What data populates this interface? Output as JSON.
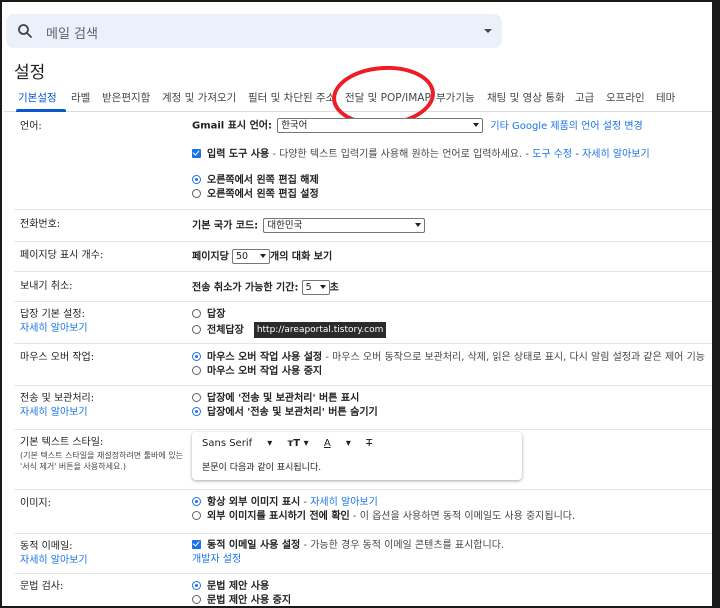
{
  "search": {
    "placeholder": "메일 검색",
    "icon": "search-icon",
    "options_icon": "dropdown-icon"
  },
  "page": {
    "title": "설정"
  },
  "tabs": [
    {
      "label": "기본설정"
    },
    {
      "label": "라벨"
    },
    {
      "label": "받은편지함"
    },
    {
      "label": "계정 및 가져오기"
    },
    {
      "label": "필터 및 차단된 주소"
    },
    {
      "label": "전달 및 POP/IMAP"
    },
    {
      "label": "부가기능"
    },
    {
      "label": "채팅 및 영상 통화"
    },
    {
      "label": "고급"
    },
    {
      "label": "오프라인"
    },
    {
      "label": "테마"
    }
  ],
  "annotation_color": "#ee1c25",
  "accent_color": "#1a73e8",
  "language": {
    "label": "언어:",
    "display_label": "Gmail 표시 언어:",
    "display_value": "한국어",
    "other_link": "기타 Google 제품의 언어 설정 변경",
    "input_tools_text": "입력 도구 사용",
    "input_tools_desc": " - 다양한 텍스트 입력기를 사용해 원하는 언어로 입력하세요. - ",
    "tool_edit_link": "도구 수정",
    "learn_more": "자세히 알아보기",
    "rtl_off": "오른쪽에서 왼쪽 편집 해제",
    "rtl_on": "오른쪽에서 왼쪽 편집 설정"
  },
  "phone": {
    "label": "전화번호:",
    "country_label": "기본 국가 코드:",
    "country_value": "대한민국"
  },
  "page_size": {
    "label": "페이지당 표시 개수:",
    "prefix": "페이지당",
    "value": "50",
    "suffix": "개의 대화 보기"
  },
  "undo_send": {
    "label": "보내기 취소:",
    "prefix": "전송 취소가 가능한 기간:",
    "value": "5",
    "suffix": "초"
  },
  "reply": {
    "label": "답장 기본 설정:",
    "learn_more": "자세히 알아보기",
    "opt1": "답장",
    "opt2": "전체답장",
    "watermark": "http://areaportal.tistory.com"
  },
  "hover": {
    "label": "마우스 오버 작업:",
    "opt1_bold": "마우스 오버 작업 사용 설정",
    "opt1_rest": " - 마우스 오버 동작으로 보관처리, 삭제, 읽은 상태로 표시, 다시 알림 설정과 같은 제어 기능",
    "opt2": "마우스 오버 작업 사용 중지"
  },
  "send_archive": {
    "label": "전송 및 보관처리:",
    "learn_more": "자세히 알아보기",
    "opt1": "답장에 '전송 및 보관처리' 버튼 표시",
    "opt2": "답장에서 '전송 및 보관처리' 버튼 숨기기"
  },
  "text_style": {
    "label": "기본 텍스트 스타일:",
    "note": "(기본 텍스트 스타일을 재설정하려면 툴바에 있는 '서식 제거' 버튼을 사용하세요.)",
    "font": "Sans Serif",
    "preview": "본문이 다음과 같이 표시됩니다."
  },
  "images": {
    "label": "이미지:",
    "opt1": "항상 외부 이미지 표시",
    "opt1_sep": " - ",
    "learn_more": "자세히 알아보기",
    "opt2_bold": "외부 이미지를 표시하기 전에 확인",
    "opt2_rest": " - 이 옵션을 사용하면 동적 이메일도 사용 중지됩니다."
  },
  "dynamic_email": {
    "label": "동적 이메일:",
    "learn_more": "자세히 알아보기",
    "check_bold": "동적 이메일 사용 설정",
    "check_rest": " - 가능한 경우 동적 이메일 콘텐츠를 표시합니다.",
    "dev_link": "개발자 설정"
  },
  "grammar": {
    "label": "문법 검사:",
    "opt1": "문법 제안 사용",
    "opt2": "문법 제안 사용 중지"
  }
}
